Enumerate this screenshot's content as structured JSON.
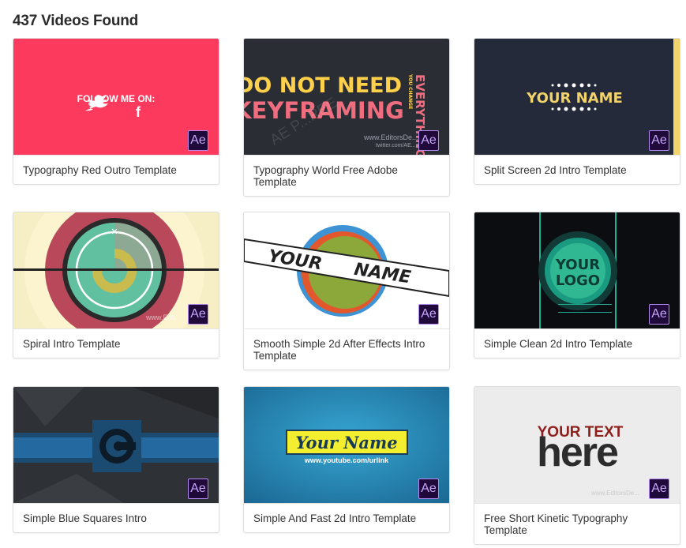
{
  "results": {
    "title": "437 Videos Found"
  },
  "cards": [
    {
      "title": "Typography Red Outro Template",
      "thumb_text": [
        "FOLLOW ME ON:"
      ]
    },
    {
      "title": "Typography World Free Adobe Template",
      "thumb_text": [
        "DO NOT NEED",
        "KEYFRAMING",
        "EVERYTHING",
        "YOU CHANGE",
        "www.EditorsDe...m",
        "twitter.com/AE...ect",
        "AE P...REE"
      ]
    },
    {
      "title": "Split Screen 2d Intro Template",
      "thumb_text": [
        "YOUR NAME"
      ]
    },
    {
      "title": "Spiral Intro Template",
      "thumb_text": [
        "www.Edit..."
      ]
    },
    {
      "title": "Smooth Simple 2d After Effects Intro Template",
      "thumb_text": [
        "YOUR",
        "NAME"
      ]
    },
    {
      "title": "Simple Clean 2d Intro Template",
      "thumb_text": [
        "YOUR",
        "LOGO"
      ]
    },
    {
      "title": "Simple Blue Squares Intro",
      "thumb_text": []
    },
    {
      "title": "Simple And Fast 2d Intro Template",
      "thumb_text": [
        "Your Name",
        "www.youtube.com/urlink"
      ]
    },
    {
      "title": "Free Short Kinetic Typography Template",
      "thumb_text": [
        "YOUR TEXT",
        "here",
        "www.EditorsDe..."
      ]
    }
  ],
  "badge": {
    "label": "Ae",
    "icon": "after-effects-icon"
  },
  "colors": {
    "badge_bg": "#1f0a3a",
    "badge_border": "#b48af2",
    "badge_text": "#c9a5ff"
  }
}
